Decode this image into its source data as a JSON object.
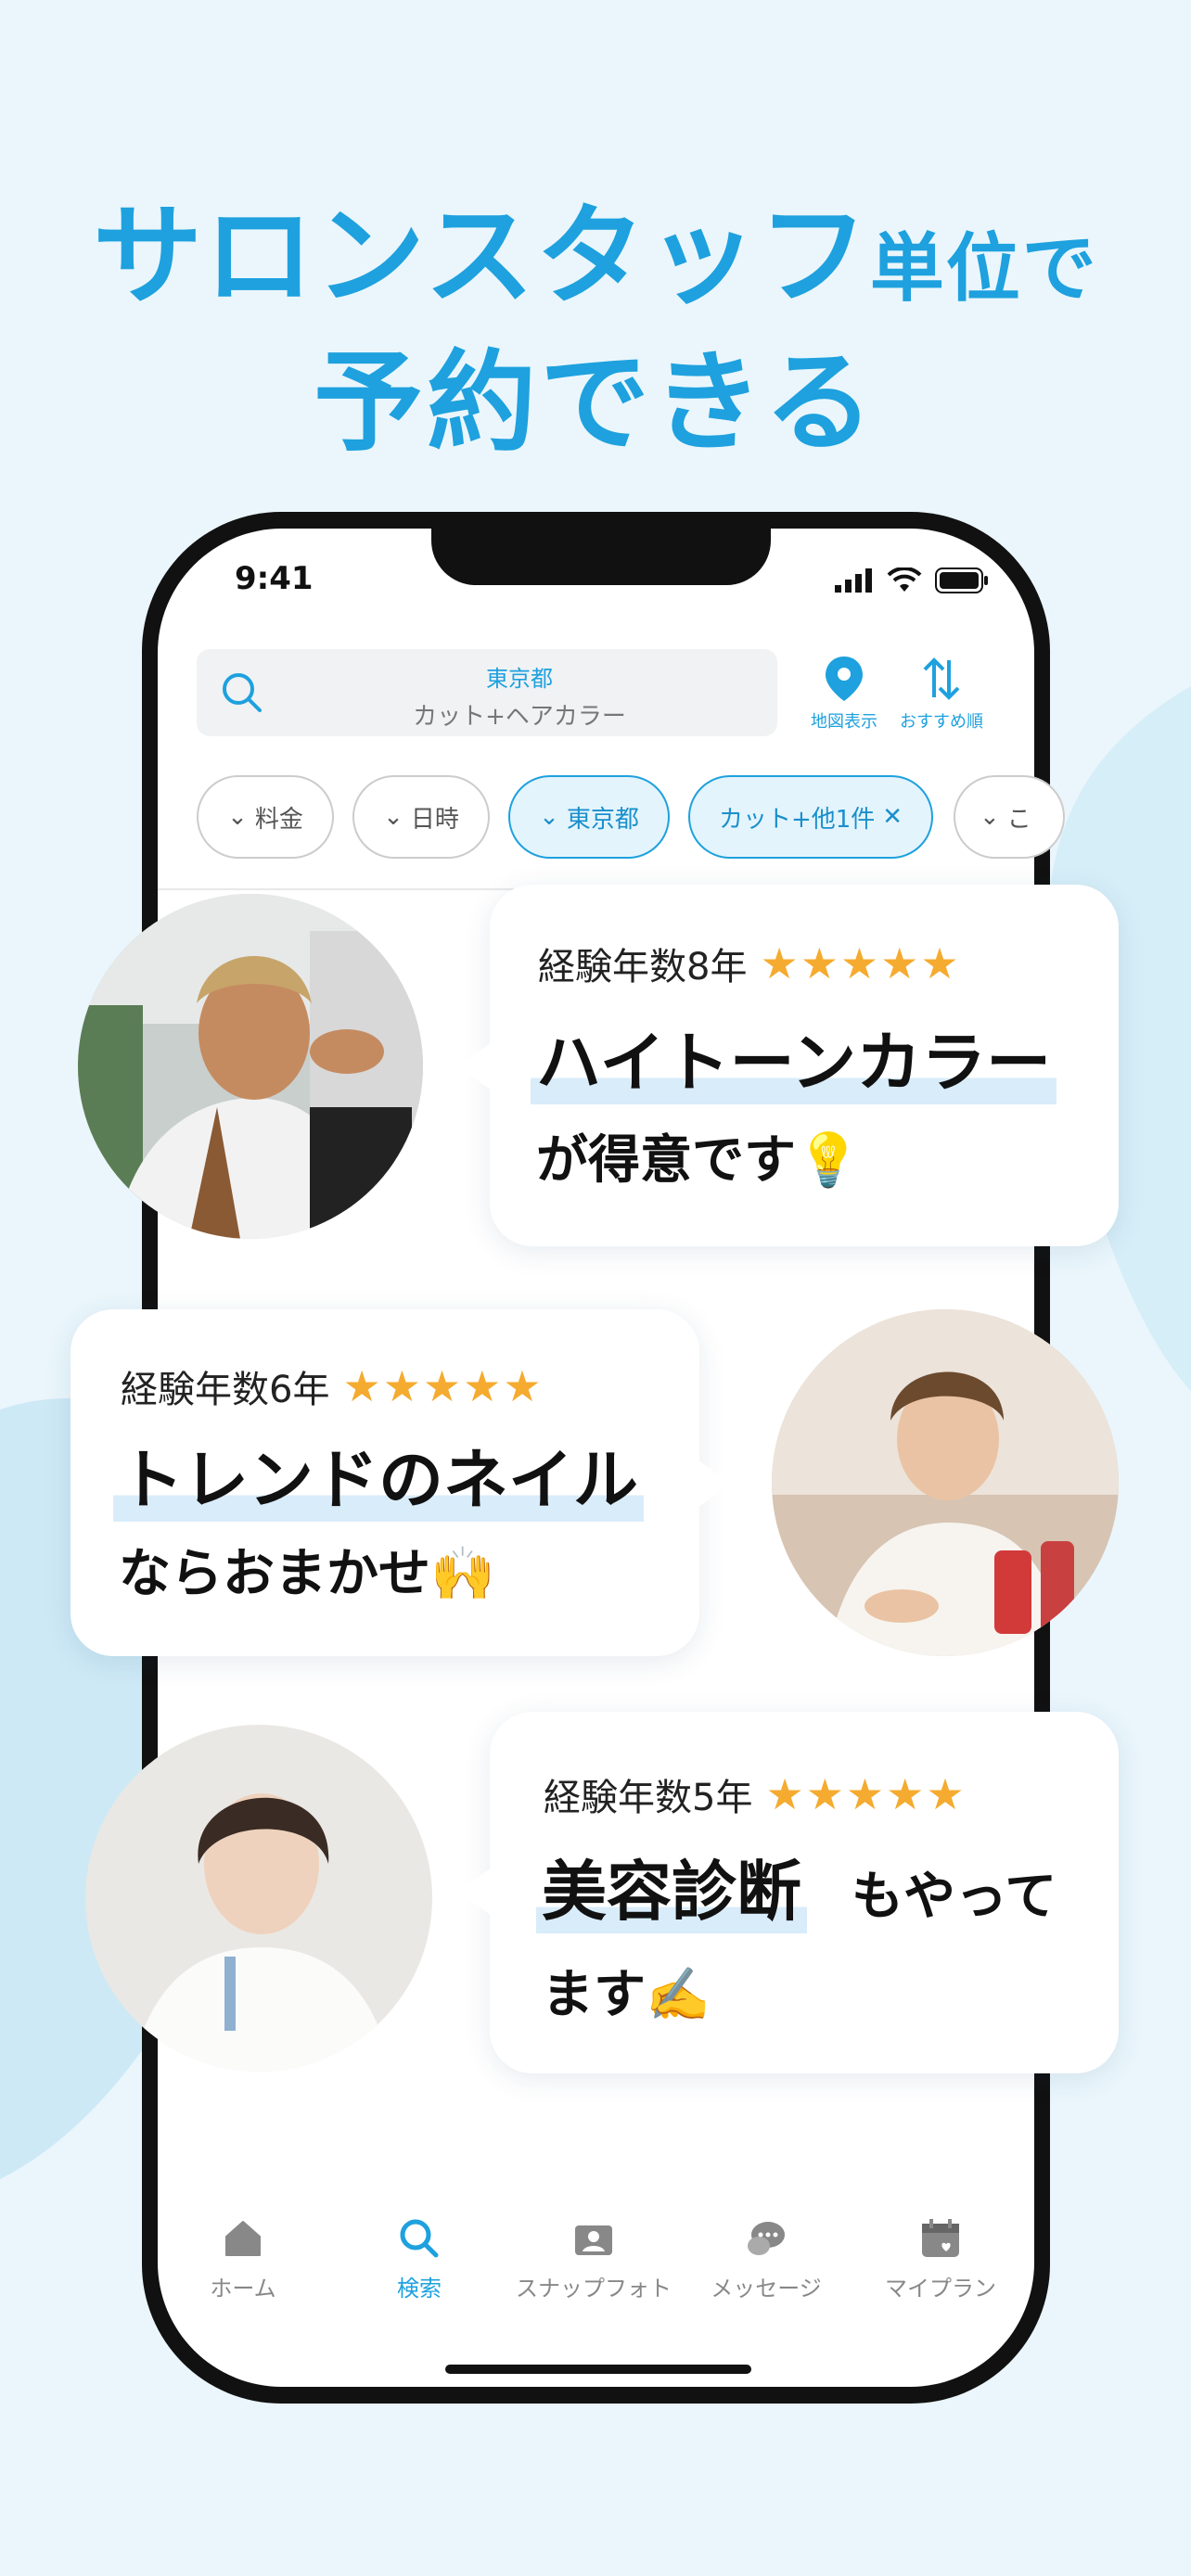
{
  "headline": {
    "line1_main": "サロンスタッフ",
    "line1_small": "単位で",
    "line2": "予約できる"
  },
  "status_bar": {
    "time": "9:41"
  },
  "search": {
    "area": "東京都",
    "menu": "カット+ヘアカラー"
  },
  "top_buttons": [
    {
      "label": "地図表示",
      "icon": "map-pin-icon"
    },
    {
      "label": "おすすめ順",
      "icon": "sort-icon"
    }
  ],
  "filters": [
    {
      "label": "料金",
      "active": false
    },
    {
      "label": "日時",
      "active": false
    },
    {
      "label": "東京都",
      "active": true
    },
    {
      "label": "カット+他1件",
      "active": true
    },
    {
      "label": "こ",
      "active": false
    }
  ],
  "stylists": [
    {
      "experience": "経験年数8年",
      "stars": "★★★★★",
      "highlight": "ハイトーンカラー",
      "rest": "が得意です💡"
    },
    {
      "experience": "経験年数6年",
      "stars": "★★★★★",
      "highlight": "トレンドのネイル",
      "rest": "ならおまかせ🙌"
    },
    {
      "experience": "経験年数5年",
      "stars": "★★★★★",
      "highlight": "美容診断",
      "rest_inline": "もやって",
      "rest": "ます✍️"
    }
  ],
  "tabs": [
    {
      "label": "ホーム",
      "icon": "home-icon",
      "active": false
    },
    {
      "label": "検索",
      "icon": "search-icon",
      "active": true
    },
    {
      "label": "スナップフォト",
      "icon": "snap-photo-icon",
      "active": false
    },
    {
      "label": "メッセージ",
      "icon": "message-icon",
      "active": false
    },
    {
      "label": "マイプラン",
      "icon": "calendar-icon",
      "active": false
    }
  ],
  "colors": {
    "accent": "#1ea1de",
    "star": "#f5ab30",
    "background": "#eaf6fc"
  }
}
